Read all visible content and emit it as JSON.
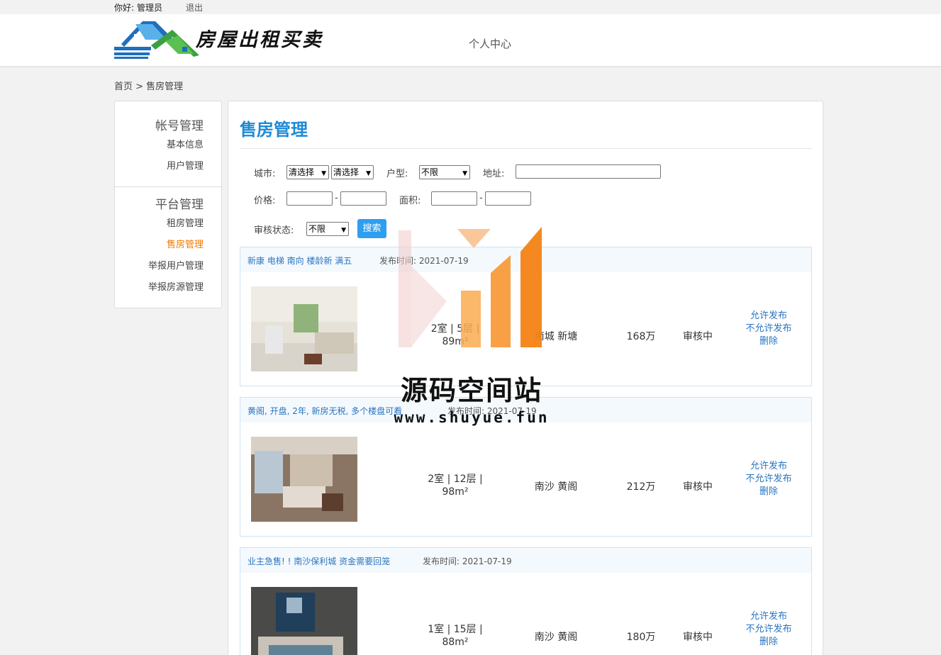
{
  "topbar": {
    "hello": "你好:",
    "user": "管理员",
    "logout": "退出"
  },
  "header": {
    "logo_text": "房屋出租买卖",
    "nav_center": "个人中心"
  },
  "breadcrumb": "首页 > 售房管理",
  "sidebar": {
    "sec1_title": "帐号管理",
    "sec1_items": [
      "基本信息",
      "用户管理"
    ],
    "sec2_title": "平台管理",
    "sec2_items": [
      "租房管理",
      "售房管理",
      "举报用户管理",
      "举报房源管理"
    ],
    "active_item": "售房管理"
  },
  "main": {
    "title": "售房管理",
    "filters": {
      "city_label": "城市:",
      "city_select1": "清选择",
      "city_select2": "清选择",
      "room_label": "户型:",
      "room_select": "不限",
      "addr_label": "地址:",
      "price_label": "价格:",
      "area_label": "面积:",
      "status_label": "审核状态:",
      "status_select": "不限",
      "dash": "-",
      "search_btn": "搜索"
    },
    "listings": [
      {
        "title": "新康 电梯 南向 楼龄新 满五",
        "date": "发布时间: 2021-07-19",
        "spec": "2室 | 5层 | 89m²",
        "area": "南城 新塘",
        "price": "168万",
        "status": "审核中",
        "allow": "允许发布",
        "deny": "不允许发布",
        "delete": "删除"
      },
      {
        "title": "黄阁, 开盘, 2年, 新房无税, 多个楼盘可看",
        "date": "发布时间: 2021-07-19",
        "spec": "2室 | 12层 | 98m²",
        "area": "南沙 黄阁",
        "price": "212万",
        "status": "审核中",
        "allow": "允许发布",
        "deny": "不允许发布",
        "delete": "删除"
      },
      {
        "title": "业主急售! ! 南沙保利城 资金需要回笼",
        "date": "发布时间: 2021-07-19",
        "spec": "1室 | 15层 | 88m²",
        "area": "南沙 黄阁",
        "price": "180万",
        "status": "审核中",
        "allow": "允许发布",
        "deny": "不允许发布",
        "delete": "删除"
      }
    ]
  },
  "watermark": {
    "text": "源码空间站",
    "url": "www.shuyue.fun"
  },
  "colors": {
    "accent": "#1e8ad6",
    "active": "#f07800",
    "link": "#2a75c0",
    "button": "#2e9ef0"
  }
}
